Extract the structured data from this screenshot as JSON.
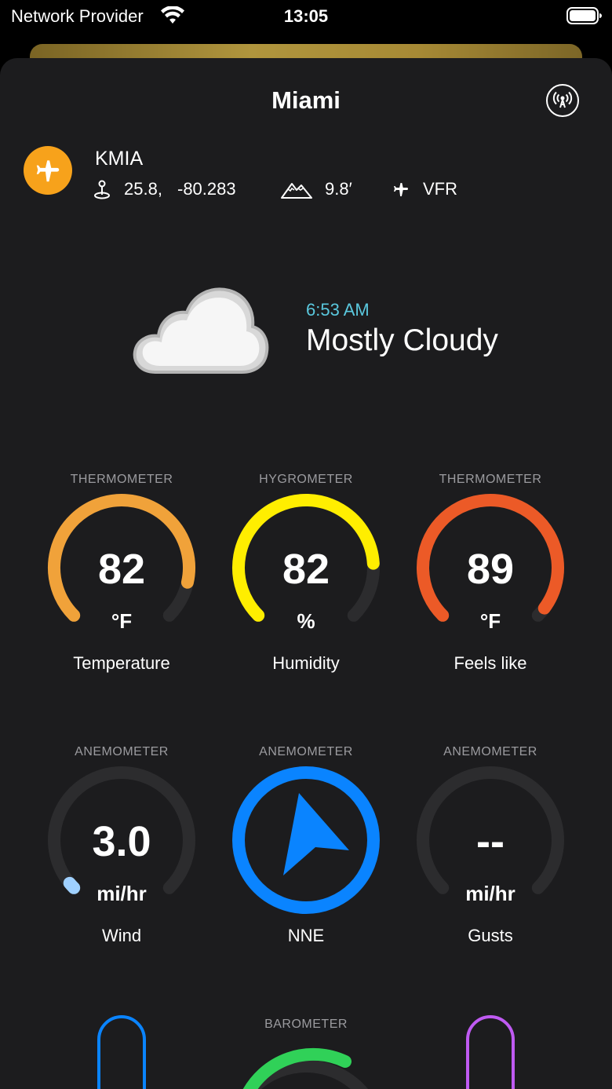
{
  "status_bar": {
    "carrier": "Network Provider",
    "time": "13:05"
  },
  "header": {
    "title": "Miami"
  },
  "station": {
    "code": "KMIA",
    "latitude": "25.8,",
    "longitude": "-80.283",
    "elevation": "9.8′",
    "flight_rules": "VFR"
  },
  "current": {
    "time": "6:53 AM",
    "conditions": "Mostly Cloudy",
    "icon": "cloud-icon"
  },
  "gauges_row1": [
    {
      "label": "THERMOMETER",
      "value": "82",
      "unit": "°F",
      "name": "Temperature",
      "color": "#f0a23a",
      "fill": 0.88
    },
    {
      "label": "HYGROMETER",
      "value": "82",
      "unit": "%",
      "name": "Humidity",
      "color": "#ffee00",
      "fill": 0.82
    },
    {
      "label": "THERMOMETER",
      "value": "89",
      "unit": "°F",
      "name": "Feels like",
      "color": "#ec5a27",
      "fill": 0.97
    }
  ],
  "gauges_row2": [
    {
      "label": "ANEMOMETER",
      "value": "3.0",
      "unit": "mi/hr",
      "name": "Wind",
      "color": "#9fd0ff",
      "fill": 0.02
    },
    {
      "label": "ANEMOMETER",
      "name": "NNE",
      "color": "#0a84ff"
    },
    {
      "label": "ANEMOMETER",
      "value": "--",
      "unit": "mi/hr",
      "name": "Gusts",
      "color": "#2c2c2e",
      "fill": 0
    }
  ],
  "row3": {
    "label": "BAROMETER",
    "left_color": "#0a84ff",
    "mid_color": "#30d158",
    "right_color": "#bf5af2"
  }
}
